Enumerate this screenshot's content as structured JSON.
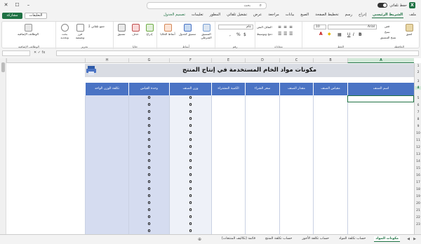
{
  "titlebar": {
    "search_placeholder": "بحث",
    "autosave_label": "حفظ تلقائي",
    "app_letter": "X"
  },
  "tabs": [
    "ملف",
    "الشريط الرئيسي",
    "إدراج",
    "رسم",
    "تخطيط الصفحة",
    "الصيغ",
    "بيانات",
    "مراجعة",
    "عرض",
    "تشغيل تلقائي",
    "المطور",
    "تعليمات",
    "تصميم الجدول"
  ],
  "active_tab": "الشريط الرئيسي",
  "context_tab": "تصميم الجدول",
  "share_label": "مشاركة",
  "comments_label": "التعليقات",
  "ribbon": {
    "clipboard": {
      "name": "الحافظة",
      "paste": "لصق",
      "cut": "قص",
      "copy": "نسخ",
      "painter": "نسخ التنسيق"
    },
    "font": {
      "name": "الخط",
      "font_name": "Arial",
      "font_size": "10"
    },
    "alignment": {
      "name": "محاذاة",
      "wrap": "التفاف النص",
      "merge": "دمج وتوسيط"
    },
    "number": {
      "name": "رقم",
      "format": "عام"
    },
    "styles": {
      "name": "أنماط",
      "cond": "التنسيق الشرطي",
      "table": "تنسيق كجدول",
      "cell": "أنماط الخلايا"
    },
    "cells": {
      "name": "خلايا",
      "insert": "إدراج",
      "delete": "حذف",
      "format": "تنسيق"
    },
    "editing": {
      "name": "تحرير",
      "sum": "جمع تلقائي",
      "sort": "فرز وتصفية",
      "find": "بحث وتحديد"
    },
    "addins": {
      "name": "الوظائف الإضافية",
      "label": "الوظائف الإضافية"
    }
  },
  "formula_bar": {
    "fx": "fx",
    "name_box": ""
  },
  "columns": [
    "A",
    "B",
    "C",
    "D",
    "E",
    "F",
    "G",
    "H"
  ],
  "rows": [
    "1",
    "2",
    "3",
    "4",
    "5",
    "6",
    "7",
    "8",
    "9",
    "10",
    "11",
    "12",
    "13",
    "14",
    "15",
    "16",
    "17",
    "18",
    "19",
    "20",
    "21",
    "22",
    "23"
  ],
  "selected_row": "4",
  "selected_col": "A",
  "sheet": {
    "title": "مكونات مواد الخام المستخدمة في إنتاج المنتج",
    "headers": [
      "اسم الصنف",
      "مقياس الصنف",
      "مقدار الصنف",
      "سعر الشراء",
      "الكمية المشتراة",
      "وزن الصنف",
      "وحدة القياس",
      "تكلفة الوزن الواحد"
    ],
    "value": "0"
  },
  "sheet_tabs": [
    "مكونات المواد",
    "حساب تكلفة المواد",
    "حساب تكلفة الأجور",
    "حساب تكلفة المنتج",
    "قائمة (تكاليف المنتجات)"
  ],
  "active_sheet": "مكونات المواد"
}
